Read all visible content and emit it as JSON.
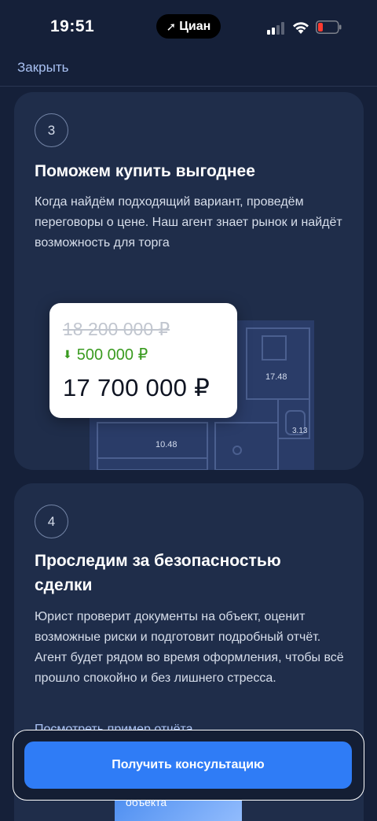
{
  "status_bar": {
    "time": "19:51",
    "app_name": "Циан"
  },
  "header": {
    "close_label": "Закрыть"
  },
  "steps": [
    {
      "number": "3",
      "title": "Поможем купить выгоднее",
      "text": "Когда найдём подходящий вариант, проведём переговоры о цене. Наш агент знает рынок и найдёт возможность для торга",
      "illustration": {
        "old_price": "18 200 000 ₽",
        "discount": "500 000 ₽",
        "new_price": "17 700 000 ₽",
        "room_areas": [
          "17.48",
          "3.13",
          "10.48"
        ]
      }
    },
    {
      "number": "4",
      "title": "Проследим за безопасностью сделки",
      "text": "Юрист проверит документы на объект, оценит возможные риски и подготовит подробный отчёт. Агент будет рядом во время оформления, чтобы всё прошло спокойно и без лишнего стресса.",
      "link_label": "Посмотреть пример отчёта",
      "thumbnail_label": "объекта"
    }
  ],
  "cta": {
    "label": "Получить консультацию"
  },
  "colors": {
    "background": "#152039",
    "card": "#1f2d4a",
    "accent": "#2f7cf6",
    "link": "#a9c1f2",
    "discount": "#3a9b20"
  }
}
